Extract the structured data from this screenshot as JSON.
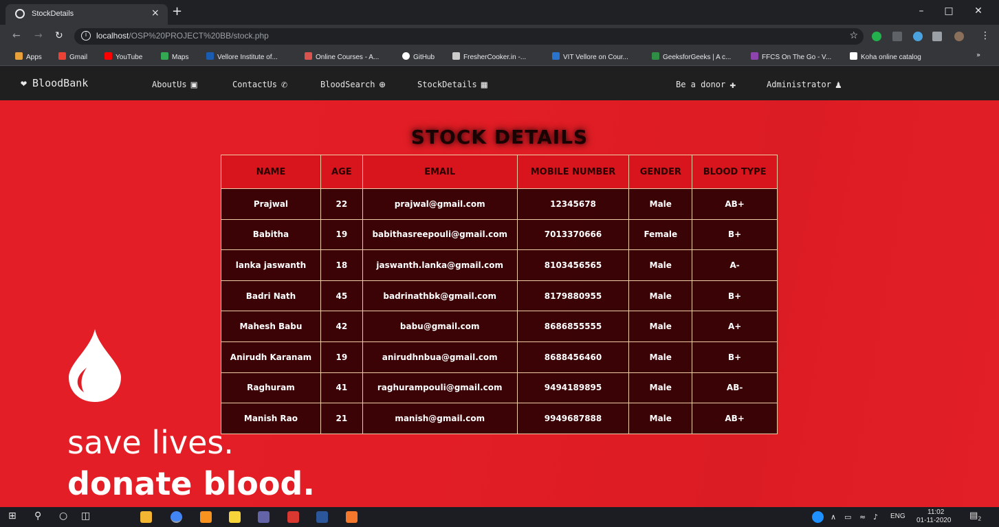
{
  "browser": {
    "tab_title": "StockDetails",
    "tab_close": "×",
    "new_tab": "+",
    "url_host": "localhost",
    "url_path": "/OSP%20PROJECT%20BB/stock.php",
    "bookmarks": [
      {
        "label": "Apps",
        "color": "#e8a03a"
      },
      {
        "label": "Gmail",
        "color": "#ea4335"
      },
      {
        "label": "YouTube",
        "color": "#ff0000"
      },
      {
        "label": "Maps",
        "color": "#34a853"
      },
      {
        "label": "Vellore Institute of...",
        "color": "#1a5cb0"
      },
      {
        "label": "Online Courses - A...",
        "color": "#d9534f"
      },
      {
        "label": "GitHub",
        "color": "#ffffff"
      },
      {
        "label": "FresherCooker.in -...",
        "color": "#cccccc"
      },
      {
        "label": "VIT Vellore on Cour...",
        "color": "#2a73cc"
      },
      {
        "label": "GeeksforGeeks | A c...",
        "color": "#2f8d46"
      },
      {
        "label": "FFCS On The Go - V...",
        "color": "#8e44ad"
      },
      {
        "label": "Koha online catalog",
        "color": "#ffffff"
      }
    ],
    "bookmarks_more": "»"
  },
  "navbar": {
    "brand": "BloodBank",
    "links": [
      {
        "label": "AboutUs",
        "icon": "id-card-icon"
      },
      {
        "label": "ContactUs",
        "icon": "phone-icon"
      },
      {
        "label": "BloodSearch",
        "icon": "search-plus-icon"
      },
      {
        "label": "StockDetails",
        "icon": "box-icon"
      },
      {
        "label": "Be a donor",
        "icon": "hand-holding-icon"
      },
      {
        "label": "Administrator",
        "icon": "user-lock-icon"
      }
    ]
  },
  "main": {
    "title": "STOCK DETAILS",
    "table": {
      "headers": [
        "NAME",
        "AGE",
        "EMAIL",
        "MOBILE NUMBER",
        "GENDER",
        "BLOOD TYPE"
      ],
      "rows": [
        [
          "Prajwal",
          "22",
          "prajwal@gmail.com",
          "12345678",
          "Male",
          "AB+"
        ],
        [
          "Babitha",
          "19",
          "babithasreepouli@gmail.com",
          "7013370666",
          "Female",
          "B+"
        ],
        [
          "lanka jaswanth",
          "18",
          "jaswanth.lanka@gmail.com",
          "8103456565",
          "Male",
          "A-"
        ],
        [
          "Badri Nath",
          "45",
          "badrinathbk@gmail.com",
          "8179880955",
          "Male",
          "B+"
        ],
        [
          "Mahesh Babu",
          "42",
          "babu@gmail.com",
          "8686855555",
          "Male",
          "A+"
        ],
        [
          "Anirudh Karanam",
          "19",
          "anirudhnbua@gmail.com",
          "8688456460",
          "Male",
          "B+"
        ],
        [
          "Raghuram",
          "41",
          "raghurampouli@gmail.com",
          "9494189895",
          "Male",
          "AB-"
        ],
        [
          "Manish Rao",
          "21",
          "manish@gmail.com",
          "9949687888",
          "Male",
          "AB+"
        ]
      ]
    },
    "slogan_line1": "save lives.",
    "slogan_line2": "donate blood."
  },
  "taskbar": {
    "tray_lang": "ENG",
    "time": "11:02",
    "date": "01-11-2020",
    "notifications": "2"
  },
  "colors": {
    "page_red": "#e21d25",
    "navbar_bg": "#1f1f1f",
    "table_header_bg": "#d8151c",
    "table_cell_bg": "#230002"
  }
}
